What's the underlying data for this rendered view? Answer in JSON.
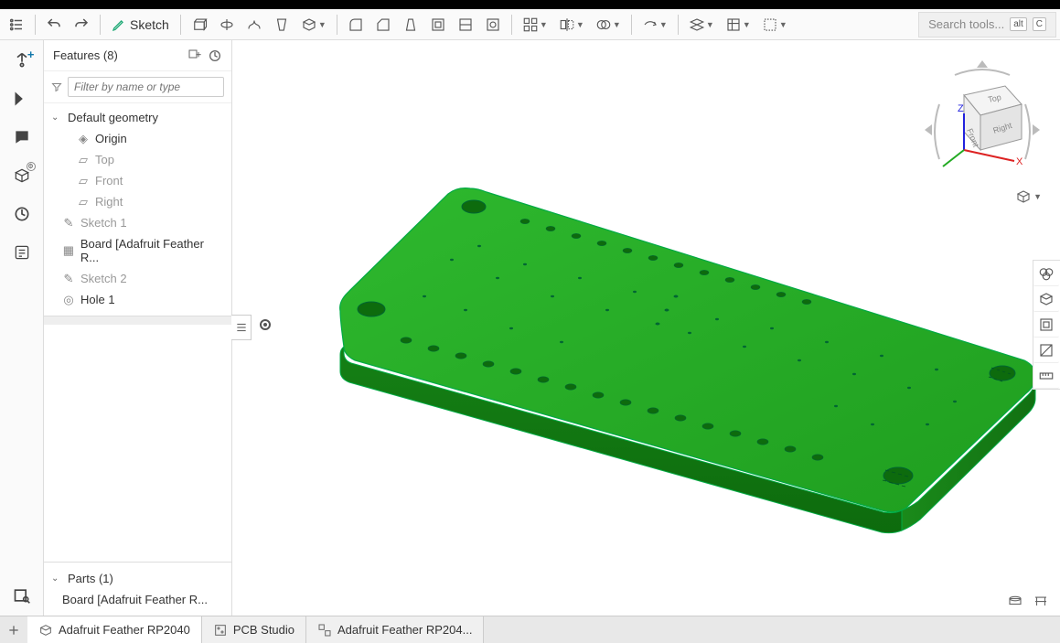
{
  "toolbar": {
    "sketch_label": "Sketch",
    "search_placeholder": "Search tools...",
    "kbd_alt": "alt",
    "kbd_c": "C"
  },
  "panel": {
    "title": "Features (8)",
    "filter_placeholder": "Filter by name or type",
    "default_geometry": "Default geometry",
    "origin": "Origin",
    "top": "Top",
    "front": "Front",
    "right": "Right",
    "sketch1": "Sketch 1",
    "board": "Board [Adafruit Feather R...",
    "sketch2": "Sketch 2",
    "hole1": "Hole 1",
    "parts_title": "Parts (1)",
    "part1": "Board [Adafruit Feather R..."
  },
  "viewcube": {
    "top": "Top",
    "front": "Front",
    "right": "Right",
    "axis_x": "X",
    "axis_z": "Z"
  },
  "tabs": {
    "tab1": "Adafruit Feather RP2040",
    "tab2": "PCB Studio",
    "tab3": "Adafruit Feather RP204..."
  }
}
